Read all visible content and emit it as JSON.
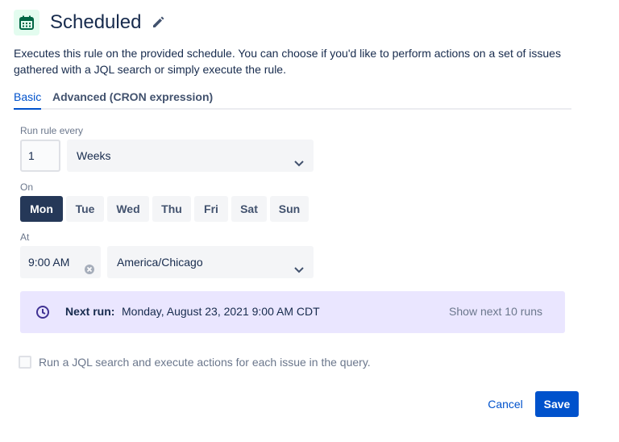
{
  "header": {
    "title": "Scheduled",
    "icon": "calendar-icon",
    "edit_icon": "pencil-icon"
  },
  "description": "Executes this rule on the provided schedule. You can choose if you'd like to perform actions on a set of issues gathered with a JQL search or simply execute the rule.",
  "tabs": [
    {
      "label": "Basic",
      "active": true
    },
    {
      "label": "Advanced (CRON expression)",
      "active": false
    }
  ],
  "run_every": {
    "label": "Run rule every",
    "value": "1",
    "unit": "Weeks"
  },
  "on": {
    "label": "On",
    "days": [
      {
        "label": "Mon",
        "selected": true
      },
      {
        "label": "Tue",
        "selected": false
      },
      {
        "label": "Wed",
        "selected": false
      },
      {
        "label": "Thu",
        "selected": false
      },
      {
        "label": "Fri",
        "selected": false
      },
      {
        "label": "Sat",
        "selected": false
      },
      {
        "label": "Sun",
        "selected": false
      }
    ]
  },
  "at": {
    "label": "At",
    "time": "9:00 AM",
    "timezone": "America/Chicago"
  },
  "next_run": {
    "label": "Next run:",
    "value": "Monday, August 23, 2021 9:00 AM CDT",
    "link": "Show next 10 runs"
  },
  "jql": {
    "label": "Run a JQL search and execute actions for each issue in the query.",
    "checked": false
  },
  "actions": {
    "cancel": "Cancel",
    "save": "Save"
  },
  "colors": {
    "primary": "#0052cc",
    "selected_day": "#253858",
    "next_run_bg": "#eae6ff",
    "calendar_badge_bg": "#e3fcef",
    "calendar_icon": "#006644"
  }
}
